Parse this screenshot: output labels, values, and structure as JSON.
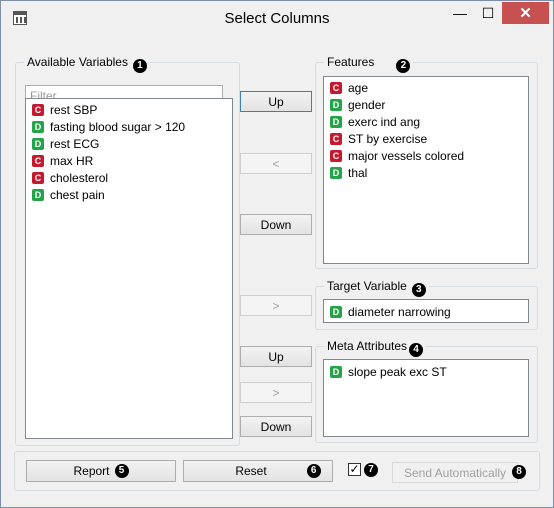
{
  "window": {
    "title": "Select Columns",
    "close_glyph": "✕",
    "min_glyph": "—",
    "max_glyph": "☐"
  },
  "available": {
    "title": "Available Variables",
    "marker": "1",
    "filter_placeholder": "Filter",
    "items": [
      {
        "type": "C",
        "label": "rest SBP"
      },
      {
        "type": "D",
        "label": "fasting blood sugar > 120"
      },
      {
        "type": "D",
        "label": "rest ECG"
      },
      {
        "type": "C",
        "label": "max HR"
      },
      {
        "type": "C",
        "label": "cholesterol"
      },
      {
        "type": "D",
        "label": "chest pain"
      }
    ]
  },
  "features": {
    "title": "Features",
    "marker": "2",
    "items": [
      {
        "type": "C",
        "label": "age"
      },
      {
        "type": "D",
        "label": "gender"
      },
      {
        "type": "D",
        "label": "exerc ind ang"
      },
      {
        "type": "C",
        "label": "ST by exercise"
      },
      {
        "type": "C",
        "label": "major vessels colored"
      },
      {
        "type": "D",
        "label": "thal"
      }
    ]
  },
  "target": {
    "title": "Target Variable",
    "marker": "3",
    "items": [
      {
        "type": "D",
        "label": "diameter narrowing"
      }
    ]
  },
  "meta": {
    "title": "Meta Attributes",
    "marker": "4",
    "items": [
      {
        "type": "D",
        "label": "slope peak exc ST"
      }
    ]
  },
  "buttons": {
    "features_up": "Up",
    "features_move": "<",
    "features_down": "Down",
    "target_move": ">",
    "meta_up": "Up",
    "meta_move": ">",
    "meta_down": "Down"
  },
  "bottom": {
    "report_label": "Report",
    "report_marker": "5",
    "reset_label": "Reset",
    "reset_marker": "6",
    "checkbox_mark": "✓",
    "checkbox_marker": "7",
    "send_label": "Send Automatically",
    "send_marker": "8"
  },
  "colors": {
    "continuous": "#c4192e",
    "discrete": "#24a348",
    "close_button": "#c75050"
  }
}
